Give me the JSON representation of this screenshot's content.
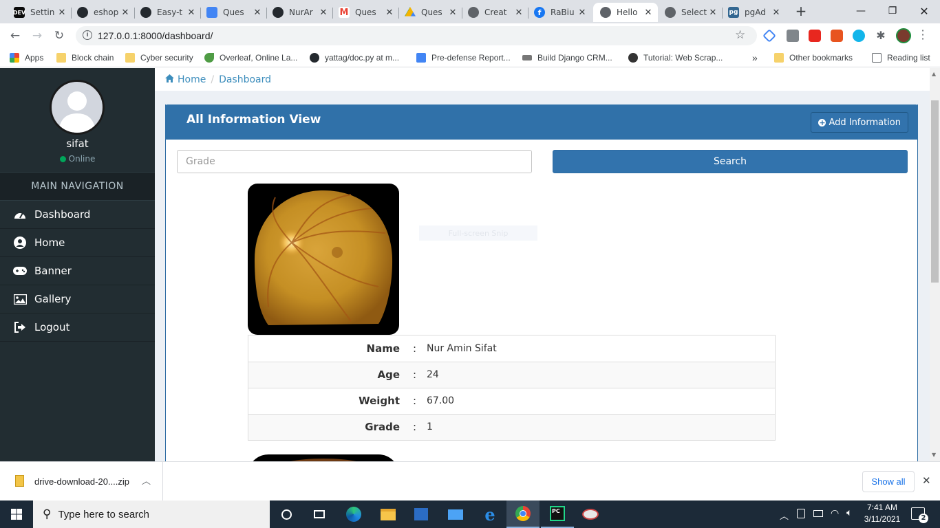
{
  "browser": {
    "tabs": [
      {
        "title": "Settin",
        "icon": "dev-icon"
      },
      {
        "title": "eshop",
        "icon": "github-icon"
      },
      {
        "title": "Easy-t",
        "icon": "github-icon"
      },
      {
        "title": "Ques",
        "icon": "docs-icon"
      },
      {
        "title": "NurAr",
        "icon": "github-icon"
      },
      {
        "title": "Ques",
        "icon": "gmail-icon"
      },
      {
        "title": "Ques",
        "icon": "drive-icon"
      },
      {
        "title": "Creat",
        "icon": "globe-icon"
      },
      {
        "title": "RaBiu",
        "icon": "facebook-icon"
      },
      {
        "title": "Hello",
        "icon": "globe-icon",
        "active": true
      },
      {
        "title": "Select",
        "icon": "globe-icon"
      },
      {
        "title": "pgAd",
        "icon": "pgadmin-icon"
      }
    ],
    "url": "127.0.0.1:8000/dashboard/",
    "bookmarks": [
      {
        "label": "Apps"
      },
      {
        "label": "Block chain"
      },
      {
        "label": "Cyber security"
      },
      {
        "label": "Overleaf, Online La..."
      },
      {
        "label": "yattag/doc.py at m..."
      },
      {
        "label": "Pre-defense Report..."
      },
      {
        "label": "Build Django CRM..."
      },
      {
        "label": "Tutorial: Web Scrap..."
      },
      {
        "label": "Other bookmarks"
      },
      {
        "label": "Reading list"
      }
    ],
    "overflow": "»"
  },
  "sidebar": {
    "username": "sifat",
    "status": "Online",
    "nav_header": "MAIN NAVIGATION",
    "items": [
      {
        "label": "Dashboard",
        "icon": "dashboard-icon"
      },
      {
        "label": "Home",
        "icon": "user-icon"
      },
      {
        "label": "Banner",
        "icon": "gamepad-icon"
      },
      {
        "label": "Gallery",
        "icon": "picture-icon"
      },
      {
        "label": "Logout",
        "icon": "sign-out-icon"
      }
    ]
  },
  "breadcrumb": {
    "home": "Home",
    "current": "Dashboard"
  },
  "panel": {
    "title": "All Information View",
    "add_button": "Add Information",
    "search_placeholder": "Grade",
    "search_button": "Search",
    "overlay_text": "Full-screen Snip"
  },
  "record": {
    "rows": [
      {
        "label": "Name",
        "sep": ":",
        "value": "Nur Amin Sifat"
      },
      {
        "label": "Age",
        "sep": ":",
        "value": "24"
      },
      {
        "label": "Weight",
        "sep": ":",
        "value": "67.00"
      },
      {
        "label": "Grade",
        "sep": ":",
        "value": "1"
      }
    ]
  },
  "download": {
    "filename": "drive-download-20....zip",
    "show_all": "Show all"
  },
  "taskbar": {
    "search_placeholder": "Type here to search",
    "time": "7:41 AM",
    "date": "3/11/2021",
    "notifications": "2"
  },
  "colors": {
    "sidebar": "#222d32",
    "header": "#3071a9",
    "link": "#3c8dbc",
    "online": "#00a65a"
  }
}
